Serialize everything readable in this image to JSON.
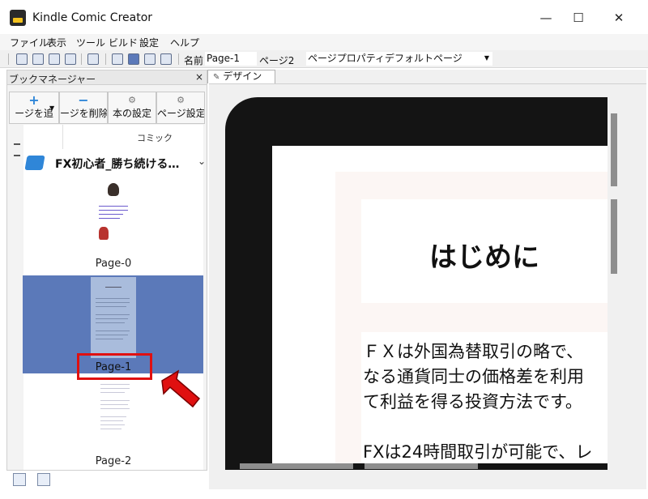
{
  "window": {
    "title": "Kindle Comic Creator",
    "minimize": "—",
    "maximize": "☐",
    "close": "✕"
  },
  "menu": [
    "ファイル",
    "表示",
    "ツール",
    "ビルド",
    "設定",
    "ヘルプ"
  ],
  "toolbar": {
    "name_label": "名前",
    "name_value": "Page-1",
    "page_label": "ページ2",
    "dropdown_value": "ページプロパティデフォルトページ"
  },
  "panel": {
    "title": "ブックマネージャー",
    "close": "×",
    "buttons": [
      "ージを追",
      "ージを削除",
      "本の設定",
      "ページ設定"
    ],
    "comic_label": "コミック",
    "book_title": "FX初心者_勝ち続ける…"
  },
  "pages": [
    "Page-0",
    "Page-1",
    "Page-2"
  ],
  "design": {
    "tab_label": "デザイン",
    "heading": "はじめに",
    "body_lines": [
      "ＦＸは外国為替取引の略で、",
      "なる通貨同士の価格差を利用",
      "て利益を得る投資方法です。",
      "",
      "FXは24時間取引が可能で、レ"
    ]
  },
  "colors": {
    "selection": "#5b79b9",
    "highlight": "#e01010"
  }
}
